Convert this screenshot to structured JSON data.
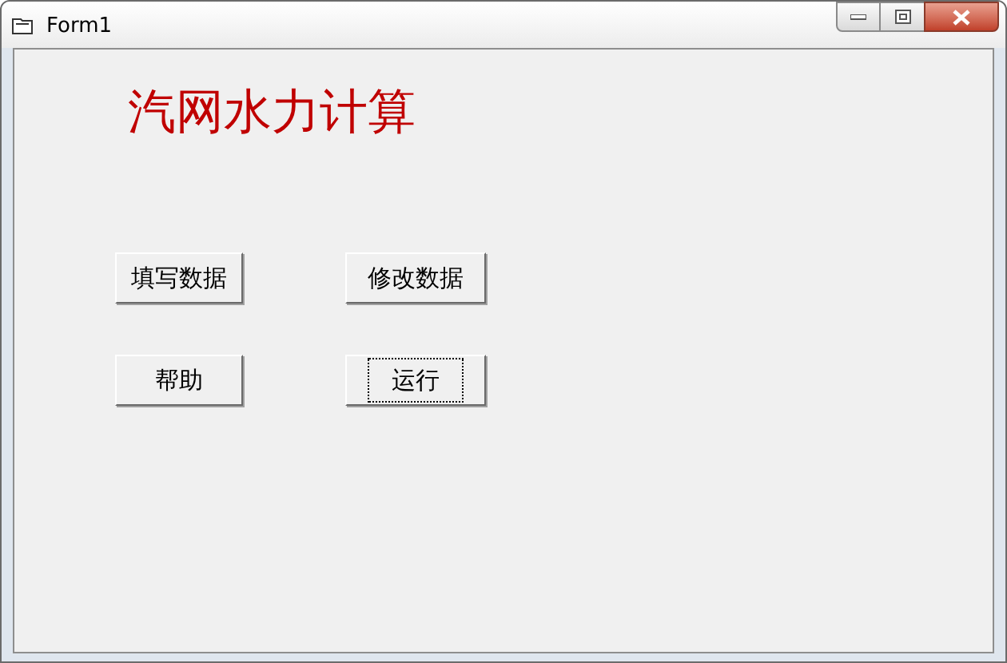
{
  "window": {
    "title": "Form1"
  },
  "heading": "汽网水力计算",
  "buttons": [
    {
      "label": "填写数据",
      "focused": false
    },
    {
      "label": "修改数据",
      "focused": false
    },
    {
      "label": "帮助",
      "focused": false
    },
    {
      "label": "运行",
      "focused": true
    }
  ]
}
